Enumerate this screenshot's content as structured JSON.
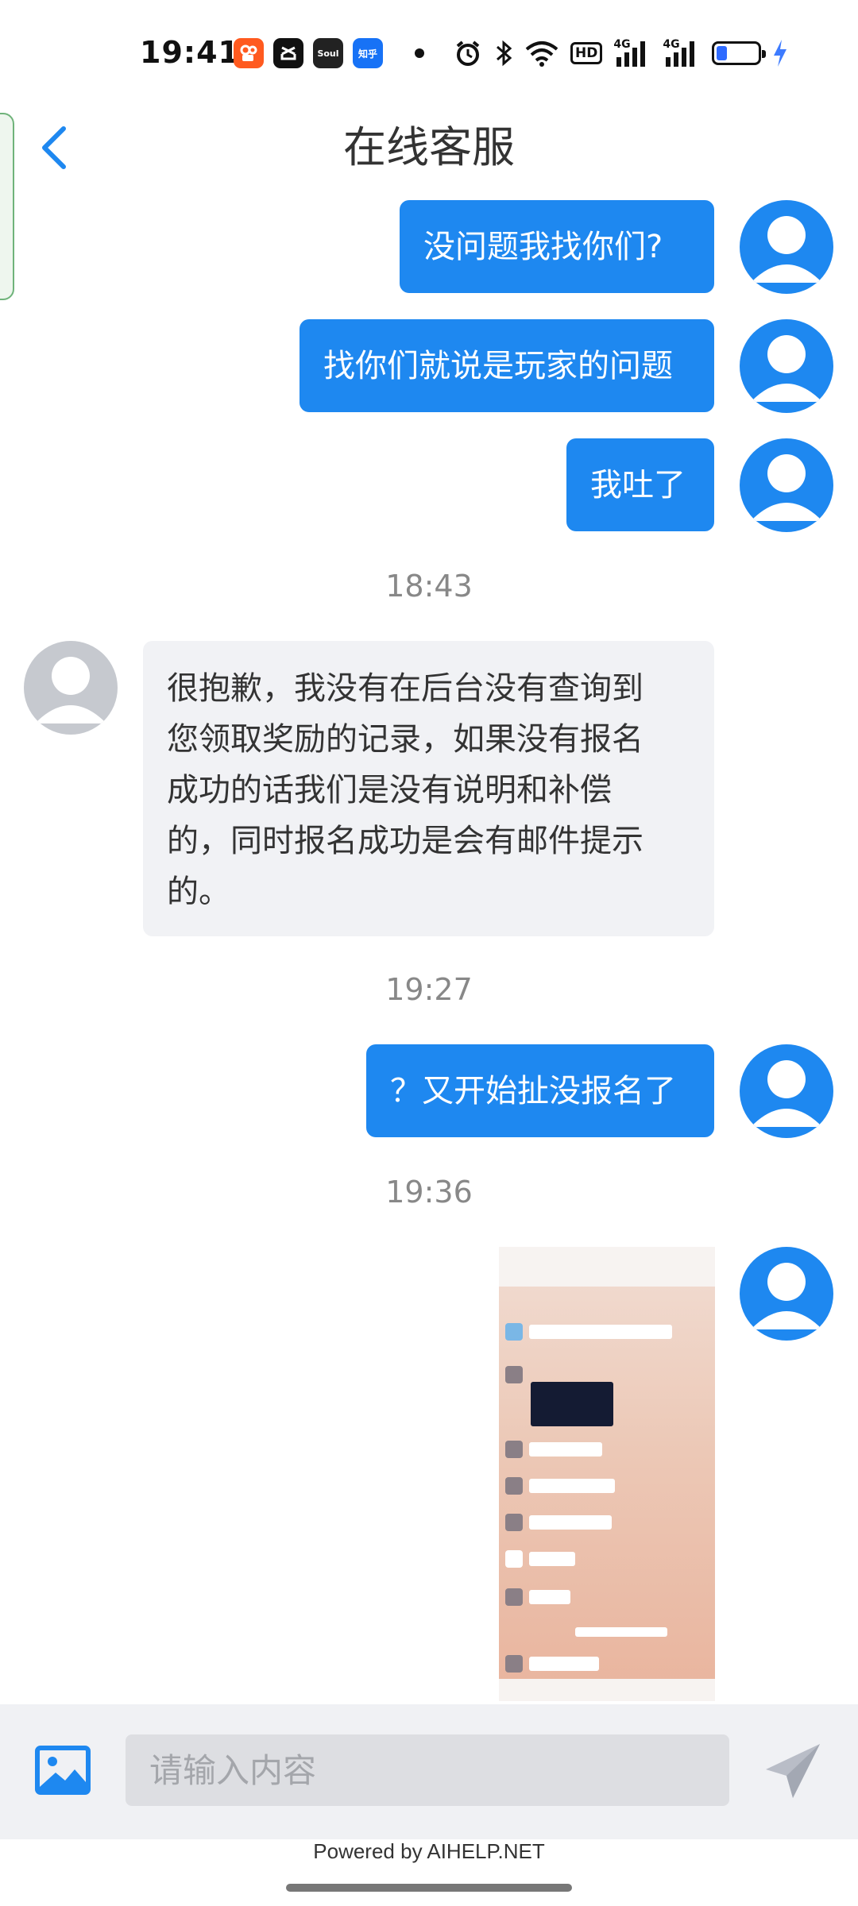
{
  "status_bar": {
    "time": "19:41",
    "apps": [
      {
        "name": "kuaishou-icon",
        "label": ""
      },
      {
        "name": "capcut-icon",
        "label": ""
      },
      {
        "name": "soul-icon",
        "label": "Soul"
      },
      {
        "name": "zhihu-icon",
        "label": "知乎"
      }
    ],
    "hd_label": "HD",
    "network_1": "4G",
    "network_2": "4G",
    "battery_level": 0.25
  },
  "header": {
    "title": "在线客服",
    "back_icon": "chevron-left-icon"
  },
  "messages": [
    {
      "side": "me",
      "text": "没问题我找你们?"
    },
    {
      "side": "me",
      "text": "找你们就说是玩家的问题"
    },
    {
      "side": "me",
      "text": "我吐了"
    },
    {
      "timestamp": "18:43"
    },
    {
      "side": "agent",
      "lines": [
        "很抱歉，我没有在后台没有查询到",
        "您领取奖励的记录，如果没有报名",
        "成功的话我们是没有说明和补偿",
        "的，同时报名成功是会有邮件提示",
        "的。"
      ]
    },
    {
      "timestamp": "19:27"
    },
    {
      "side": "me",
      "text": "？又开始扯没报名了"
    },
    {
      "timestamp": "19:36"
    },
    {
      "side": "me",
      "type": "image",
      "description": "聊天截图"
    }
  ],
  "input_bar": {
    "image_icon": "image-icon",
    "placeholder": "请输入内容",
    "send_icon": "send-icon"
  },
  "footer": {
    "powered_by": "Powered by AIHELP.NET"
  },
  "colors": {
    "accent": "#1e88f0",
    "agent_bubble": "#f1f2f5",
    "input_bg": "#f0f1f4"
  }
}
